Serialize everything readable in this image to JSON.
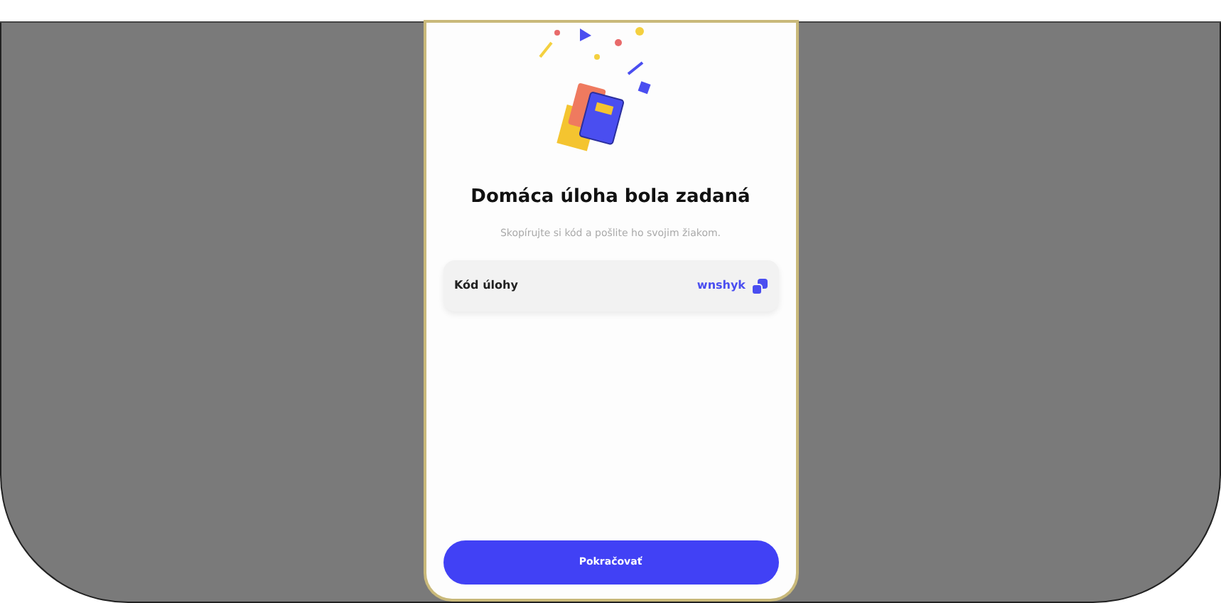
{
  "screen": {
    "title": "Domáca úloha bola zadaná",
    "subtitle": "Skopírujte si kód a pošlite ho svojim žiakom.",
    "code_row": {
      "label": "Kód úlohy",
      "value": "wnshyk"
    },
    "button": "Pokračovať"
  }
}
